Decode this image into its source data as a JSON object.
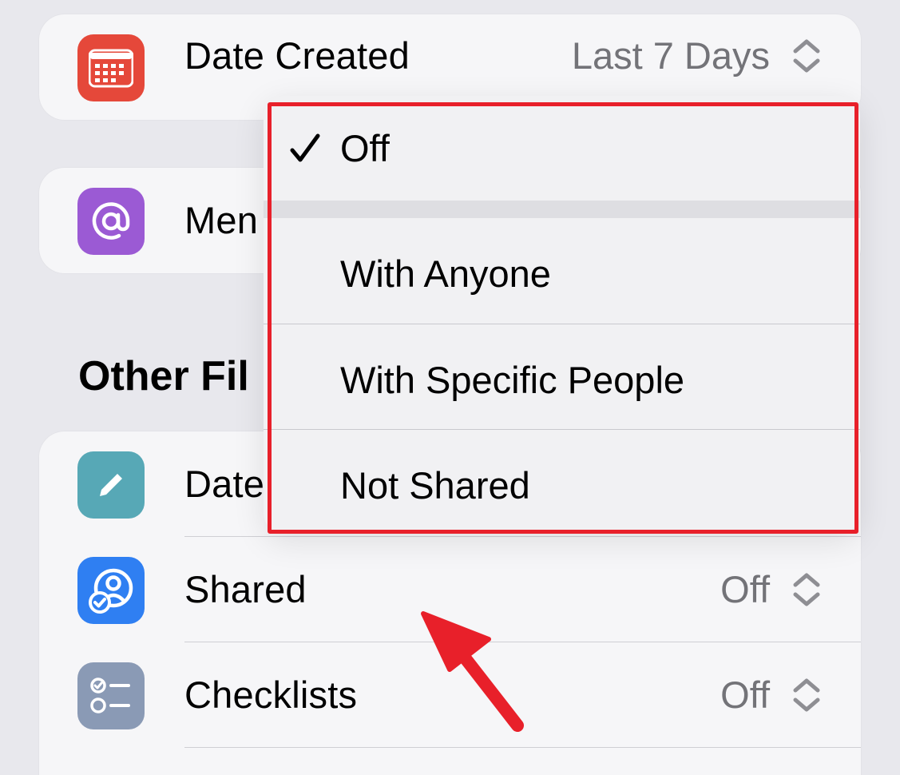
{
  "top_rows": [
    {
      "label": "Date Created",
      "value": "Last 7 Days",
      "icon": "calendar-icon",
      "icon_color": "#e5483a"
    },
    {
      "label": "Men",
      "icon": "at-sign-icon",
      "icon_color": "#9b5ad4"
    }
  ],
  "section_title": "Other Fil",
  "other_rows": [
    {
      "label": "Date",
      "icon": "pencil-icon",
      "icon_color": "#57a8b6"
    },
    {
      "label": "Shared",
      "value": "Off",
      "icon": "shared-person-icon",
      "icon_color": "#2f7ff2"
    },
    {
      "label": "Checklists",
      "value": "Off",
      "icon": "checklist-icon",
      "icon_color": "#8a9ab5"
    }
  ],
  "menu": {
    "items": [
      "Off",
      "With Anyone",
      "With Specific People",
      "Not Shared"
    ],
    "selected": "Off"
  },
  "annotation_color": "#e8202a"
}
